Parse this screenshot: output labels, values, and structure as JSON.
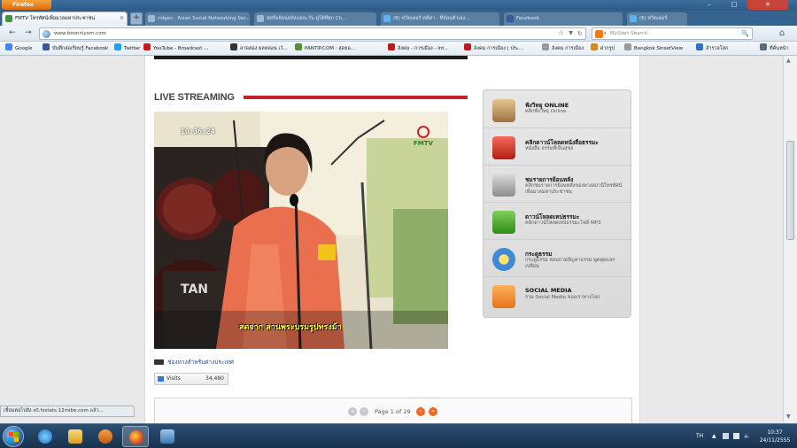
{
  "browser": {
    "app_button_label": "Firefox",
    "tabs": [
      {
        "title": "FMTV โทรทัศน์เพื่อมวลมหาประชาชน",
        "active": true
      },
      {
        "title": "ridges : Asian Social Networking Ser...",
        "active": false
      },
      {
        "title": "สตรีมย้อนหลังแต่ละวัน ดูได้ที่ทุก Ch...",
        "active": false
      },
      {
        "title": "(6) ทวิตเตอร์ คดีค่า - ที่ล้อมตัวเอง...",
        "active": false
      },
      {
        "title": "Facebook",
        "active": false
      },
      {
        "title": "(6) ทวิตเตอร์",
        "active": false
      }
    ],
    "new_tab_label": "+",
    "url": "www.boonniyom.com",
    "search_placeholder": "MyStart Search",
    "bookmarks": [
      {
        "label": "Google",
        "color": "#4285f4"
      },
      {
        "label": "บันทึกล่อเรียนรู้ Facebook",
        "color": "#3b5998"
      },
      {
        "label": "Twitter",
        "color": "#1da1f2"
      },
      {
        "label": "YouTube - Broadcast ...",
        "color": "#cc181e"
      },
      {
        "label": "ลาดล่อง ผลหลอน เว้...",
        "color": "#333333"
      },
      {
        "label": "PANTIP.COM : สุดยอ...",
        "color": "#5a8f3a"
      },
      {
        "label": "ล้งคม - การเมือง - Int...",
        "color": "#c21a1a"
      },
      {
        "label": "ล้งคม การเมือง | ประ...",
        "color": "#c21a1a"
      },
      {
        "label": "ล้งคม การเมือง",
        "color": "#999999"
      },
      {
        "label": "ฝากรูป",
        "color": "#d28b1f"
      },
      {
        "label": "Bangkok StreetView",
        "color": "#999999"
      },
      {
        "label": "สำรวจโลก",
        "color": "#2f72c6"
      },
      {
        "label": "ที่คั่นหน้า",
        "color": "#5a6d80"
      }
    ],
    "status_text": "เชื่อมต่อไปยัง s0.histats.12mibe.com แล้ว..."
  },
  "page": {
    "live_title": "LIVE STREAMING",
    "video": {
      "timestamp": "10:36:24",
      "caption": "สดจาก ลานพระบรมรูปทรงม้า",
      "logo_text": "FMTV"
    },
    "channel_link": "ช่องทางสำหรับต่างประเทศ",
    "visits_label": "Visits",
    "visits_count": "34,480",
    "pager": {
      "text": "Page 1 of 29"
    },
    "menu": [
      {
        "title": "ฟังวิทยุ ONLINE",
        "desc": "คลิกฟังวิทยุ Online",
        "icon": "radio-icon"
      },
      {
        "title": "คลิกดาวน์โหลดหนังสือธรรมะ",
        "desc": "หนังสือ ธรรมที่เป็นสุขจ",
        "icon": "pdf-icon"
      },
      {
        "title": "ชมรายการย้อนหลัง",
        "desc": "คลิกชมรายการย้อนหลังของทางสถานีโทรทัศน์เพื่อมวลมหาประชาชน",
        "icon": "film-icon"
      },
      {
        "title": "ดาวน์โหลดเทปธรรมะ",
        "desc": "คลิกดาวน์โหลดเทปธรรมะไฟล์ MP3",
        "icon": "music-icon"
      },
      {
        "title": "กระดูธรรม",
        "desc": "กระดูธรรม สอบถามปัญหาธรรม พูดคุยแลกเปลี่ยน",
        "icon": "chat-icon"
      },
      {
        "title": "SOCIAL MEDIA",
        "desc": "รวม Social Media ของเราทางโลก",
        "icon": "rss-icon"
      }
    ]
  },
  "taskbar": {
    "language": "TH",
    "time": "10:37",
    "date": "24/11/2555"
  }
}
